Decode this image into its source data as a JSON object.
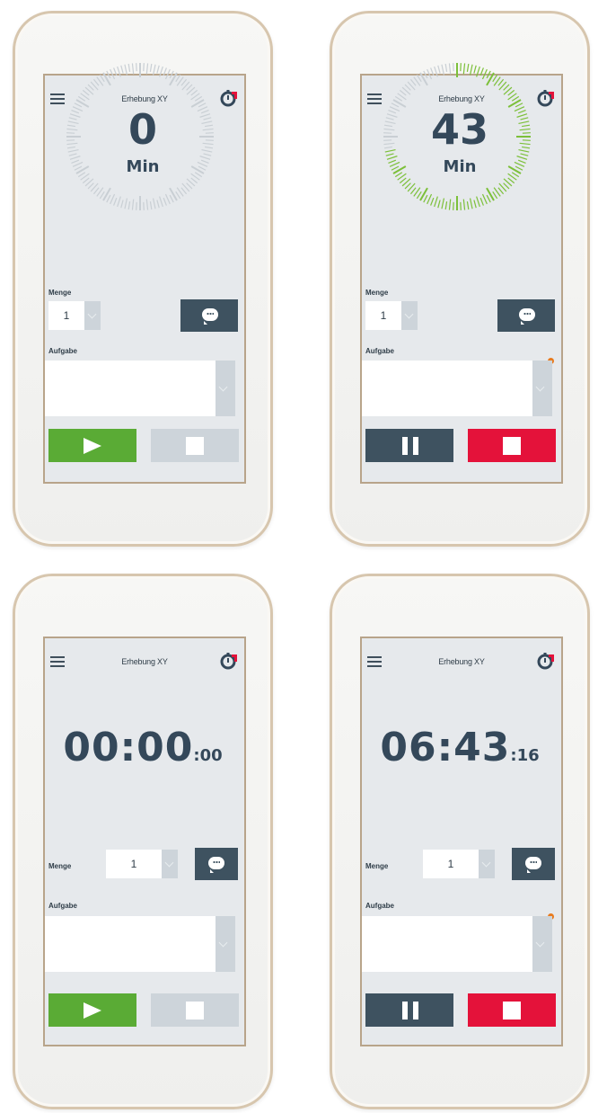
{
  "colors": {
    "accent_green": "#5aab35",
    "stop_red": "#e4123a",
    "dark": "#3e5260",
    "dial_progress": "#7cc03a"
  },
  "screens": [
    {
      "header": {
        "title": "Erhebung XY",
        "menu_icon": "hamburger-icon",
        "logo_icon": "timer-logo-icon"
      },
      "dial": {
        "value": "0",
        "unit": "Min",
        "progress": 0
      },
      "menge_label": "Menge",
      "menge_value": "1",
      "aufgabe_label": "Aufgabe",
      "primary_icon": "play-icon",
      "secondary_icon": "stop-icon",
      "state": "idle"
    },
    {
      "header": {
        "title": "Erhebung XY",
        "menu_icon": "hamburger-icon",
        "logo_icon": "timer-logo-icon"
      },
      "dial": {
        "value": "43",
        "unit": "Min",
        "progress": 0.72
      },
      "menge_label": "Menge",
      "menge_value": "1",
      "aufgabe_label": "Aufgabe",
      "primary_icon": "pause-icon",
      "secondary_icon": "stop-icon",
      "state": "running"
    },
    {
      "header": {
        "title": "Erhebung XY",
        "menu_icon": "hamburger-icon",
        "logo_icon": "timer-logo-icon"
      },
      "clock": {
        "main": "00:00",
        "fraction": ":00"
      },
      "menge_label": "Menge",
      "menge_value": "1",
      "aufgabe_label": "Aufgabe",
      "primary_icon": "play-icon",
      "secondary_icon": "stop-icon",
      "state": "idle"
    },
    {
      "header": {
        "title": "Erhebung XY",
        "menu_icon": "hamburger-icon",
        "logo_icon": "timer-logo-icon"
      },
      "clock": {
        "main": "06:43",
        "fraction": ":16"
      },
      "menge_label": "Menge",
      "menge_value": "1",
      "aufgabe_label": "Aufgabe",
      "primary_icon": "pause-icon",
      "secondary_icon": "stop-icon",
      "state": "running"
    }
  ]
}
